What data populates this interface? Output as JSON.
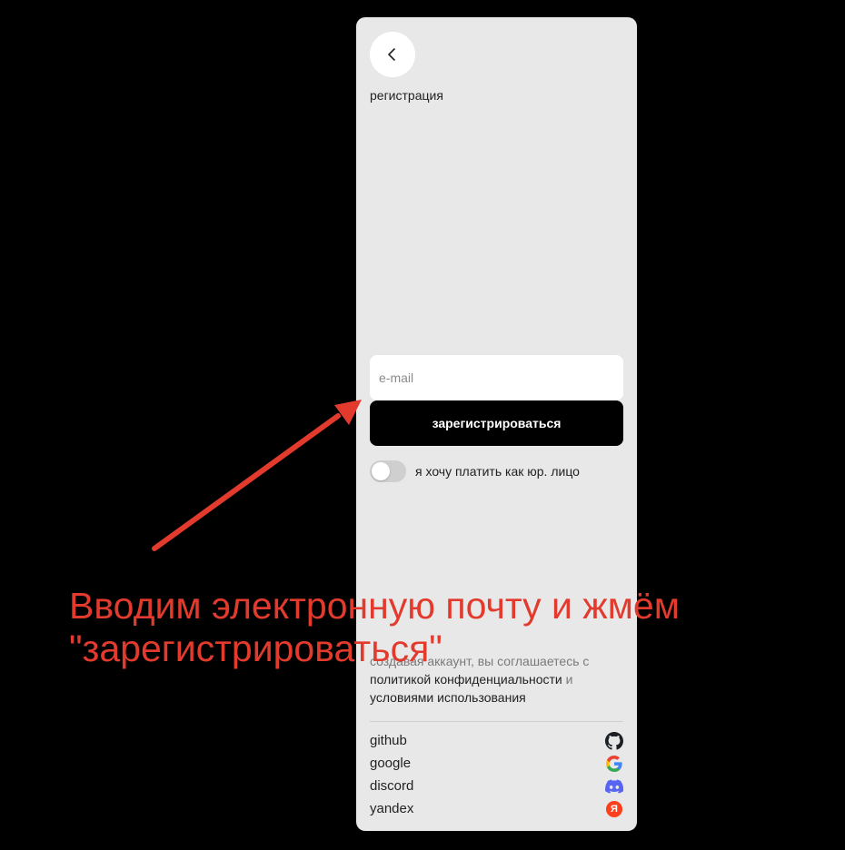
{
  "header": {
    "back_icon": "chevron-left-icon",
    "title": "регистрация"
  },
  "form": {
    "email_placeholder": "e-mail",
    "email_value": "",
    "submit_label": "зарегистрироваться"
  },
  "legal_entity": {
    "label": "я хочу платить как юр. лицо",
    "checked": false
  },
  "terms": {
    "prefix": "создавая аккаунт, вы соглашаетесь с",
    "privacy_link": "политикой конфиденциальности",
    "conjunction": "и",
    "tos_link": "условиями использования"
  },
  "providers": [
    {
      "label": "github",
      "icon": "github-icon"
    },
    {
      "label": "google",
      "icon": "google-icon"
    },
    {
      "label": "discord",
      "icon": "discord-icon"
    },
    {
      "label": "yandex",
      "icon": "yandex-icon",
      "badge": "Я"
    }
  ],
  "annotation": {
    "text_line1": "Вводим электронную почту и жмём",
    "text_line2": "\"зарегистрироваться\"",
    "color": "#e23b2e"
  },
  "colors": {
    "page_bg": "#000000",
    "panel_bg": "#e8e8e8",
    "button_bg": "#000000",
    "yandex_red": "#fc3f1d",
    "discord_blurple": "#5865f2"
  }
}
